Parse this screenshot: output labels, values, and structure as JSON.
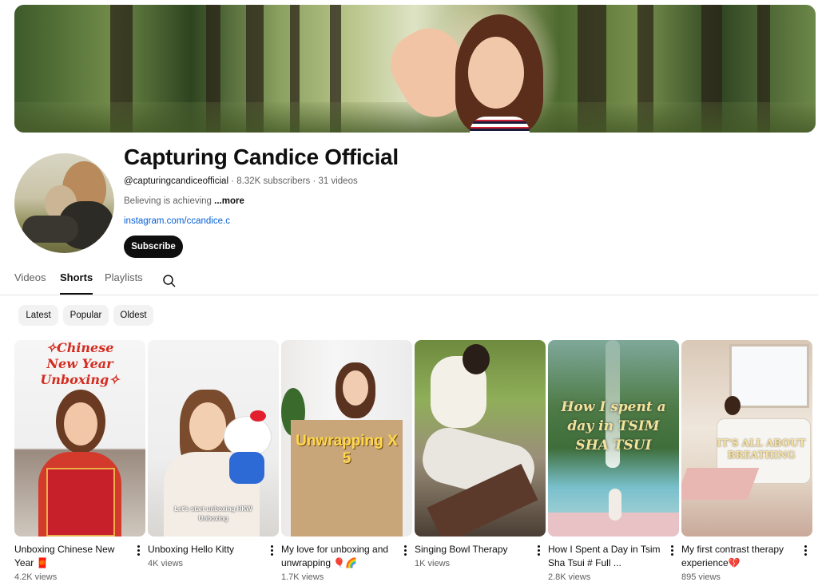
{
  "channel": {
    "name": "Capturing Candice Official",
    "handle": "@capturingcandiceofficial",
    "stats": " · 8.32K subscribers · 31 videos",
    "description": "Believing is achieving",
    "more_label": " ...more",
    "link": "instagram.com/ccandice.c",
    "subscribe_label": "Subscribe"
  },
  "tabs": [
    {
      "label": "Videos",
      "active": false
    },
    {
      "label": "Shorts",
      "active": true
    },
    {
      "label": "Playlists",
      "active": false
    }
  ],
  "chips": [
    "Latest",
    "Popular",
    "Oldest"
  ],
  "shorts": [
    {
      "title": "Unboxing Chinese New Year 🧧",
      "views": "4.2K views",
      "overlay": "✧Chinese New Year Unboxing✧"
    },
    {
      "title": "Unboxing Hello Kitty",
      "views": "4K views",
      "overlay": "Let's start unboxing HKW Unboxing"
    },
    {
      "title": "My love for unboxing and unwrapping 🎈🌈",
      "views": "1.7K views",
      "overlay": "Unwrapping X 5"
    },
    {
      "title": "Singing Bowl Therapy",
      "views": "1K views",
      "overlay": ""
    },
    {
      "title": "How I Spent a Day in Tsim Sha Tsui # Full ...",
      "views": "2.8K views",
      "overlay": "How I spent a day in TSIM SHA TSUI"
    },
    {
      "title": "My first contrast therapy experience💔",
      "views": "895 views",
      "overlay": "IT'S ALL ABOUT BREATHING"
    }
  ],
  "colors": {
    "accent_link": "#065fd4",
    "subscribe_bg": "#0f0f0f",
    "chip_bg": "#f2f2f2",
    "secondary_text": "#606060"
  },
  "icons": {
    "search": "search-icon",
    "menu": "more-vert-icon"
  }
}
